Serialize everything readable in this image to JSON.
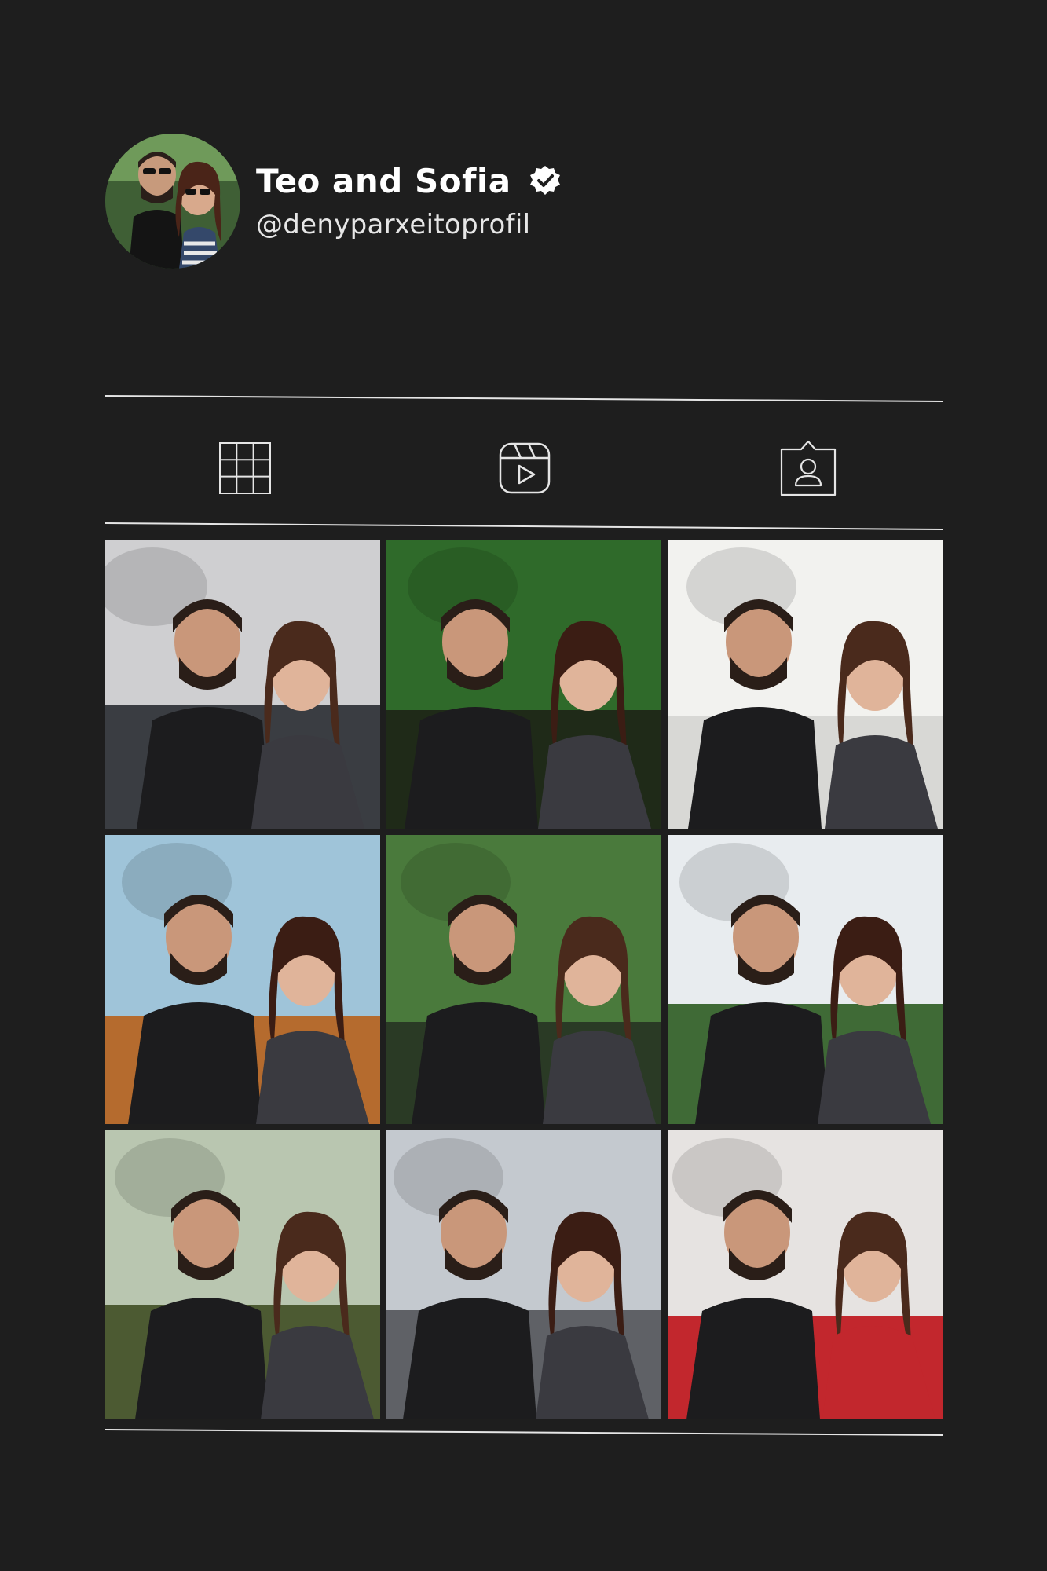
{
  "profile": {
    "display_name": "Teo and Sofia",
    "username": "@denyparxeitoprofil",
    "verified": true,
    "avatar_icon": "couple-photo-avatar"
  },
  "tabs": [
    {
      "icon": "grid-icon",
      "active": true
    },
    {
      "icon": "reels-icon",
      "active": false
    },
    {
      "icon": "tagged-user-icon",
      "active": false
    }
  ],
  "photos": [
    {
      "icon": "couple-photo",
      "scene": "snow",
      "sky": "#cfcfd1",
      "ground": "#3a3d42"
    },
    {
      "icon": "couple-photo",
      "scene": "forest",
      "sky": "#2f6a2a",
      "ground": "#1f2a18"
    },
    {
      "icon": "couple-photo",
      "scene": "bright",
      "sky": "#f2f2ef",
      "ground": "#d8d8d5"
    },
    {
      "icon": "couple-photo",
      "scene": "trees",
      "sky": "#9fc4d9",
      "ground": "#b56b2e"
    },
    {
      "icon": "couple-photo",
      "scene": "park",
      "sky": "#4a7a3c",
      "ground": "#2a3a25"
    },
    {
      "icon": "couple-photo",
      "scene": "palms",
      "sky": "#e8ecef",
      "ground": "#3f6a36"
    },
    {
      "icon": "couple-photo",
      "scene": "woods",
      "sky": "#b9c6b0",
      "ground": "#4c5a32"
    },
    {
      "icon": "couple-photo",
      "scene": "overcast",
      "sky": "#c4c9cf",
      "ground": "#5f6166"
    },
    {
      "icon": "couple-photo",
      "scene": "indoor",
      "sky": "#e6e3e1",
      "ground": "#c2272d"
    }
  ],
  "colors": {
    "background": "#1e1e1e",
    "divider": "#e5e5e5",
    "text": "#ffffff"
  }
}
